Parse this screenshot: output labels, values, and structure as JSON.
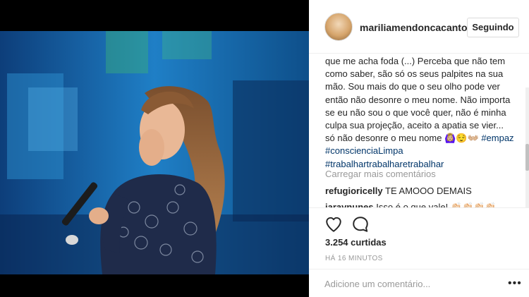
{
  "post": {
    "username": "mariliamendoncacanto",
    "follow_label": "Seguindo",
    "caption": {
      "text": "que me acha foda (...) Perceba que não tem como saber, são só os seus palpites na sua mão. Sou mais do que o seu olho pode ver então não desonre o meu nome. Não importa se eu não sou o que você quer, não é minha culpa sua projeção, aceito a apatia se vier... só não desonre o meu nome",
      "emoji": "🙆🏼‍♀️😌👐🏼",
      "hashtags": [
        "#empaz",
        "#conscienciaLimpa",
        "#trabalhartrabalharetrabalhar"
      ]
    },
    "load_more_label": "Carregar mais comentários",
    "comments": [
      {
        "user": "refugioricelly",
        "text": "TE AMOOO DEMAIS"
      },
      {
        "user": "iaravnunes",
        "text": "Isso é o que vale! 👏🏻👏🏻👏🏻👏🏻"
      }
    ],
    "likes": "3.254 curtidas",
    "timestamp": "HÁ 16 MINUTOS",
    "comment_placeholder": "Adicione um comentário...",
    "icons": {
      "like": "heart-icon",
      "comment": "comment-bubble-icon",
      "more": "more-options-icon"
    }
  },
  "colors": {
    "text": "#262626",
    "muted": "#999999",
    "hashtag": "#003569",
    "border": "#efefef",
    "stage_blue": "#1a6eb0"
  }
}
